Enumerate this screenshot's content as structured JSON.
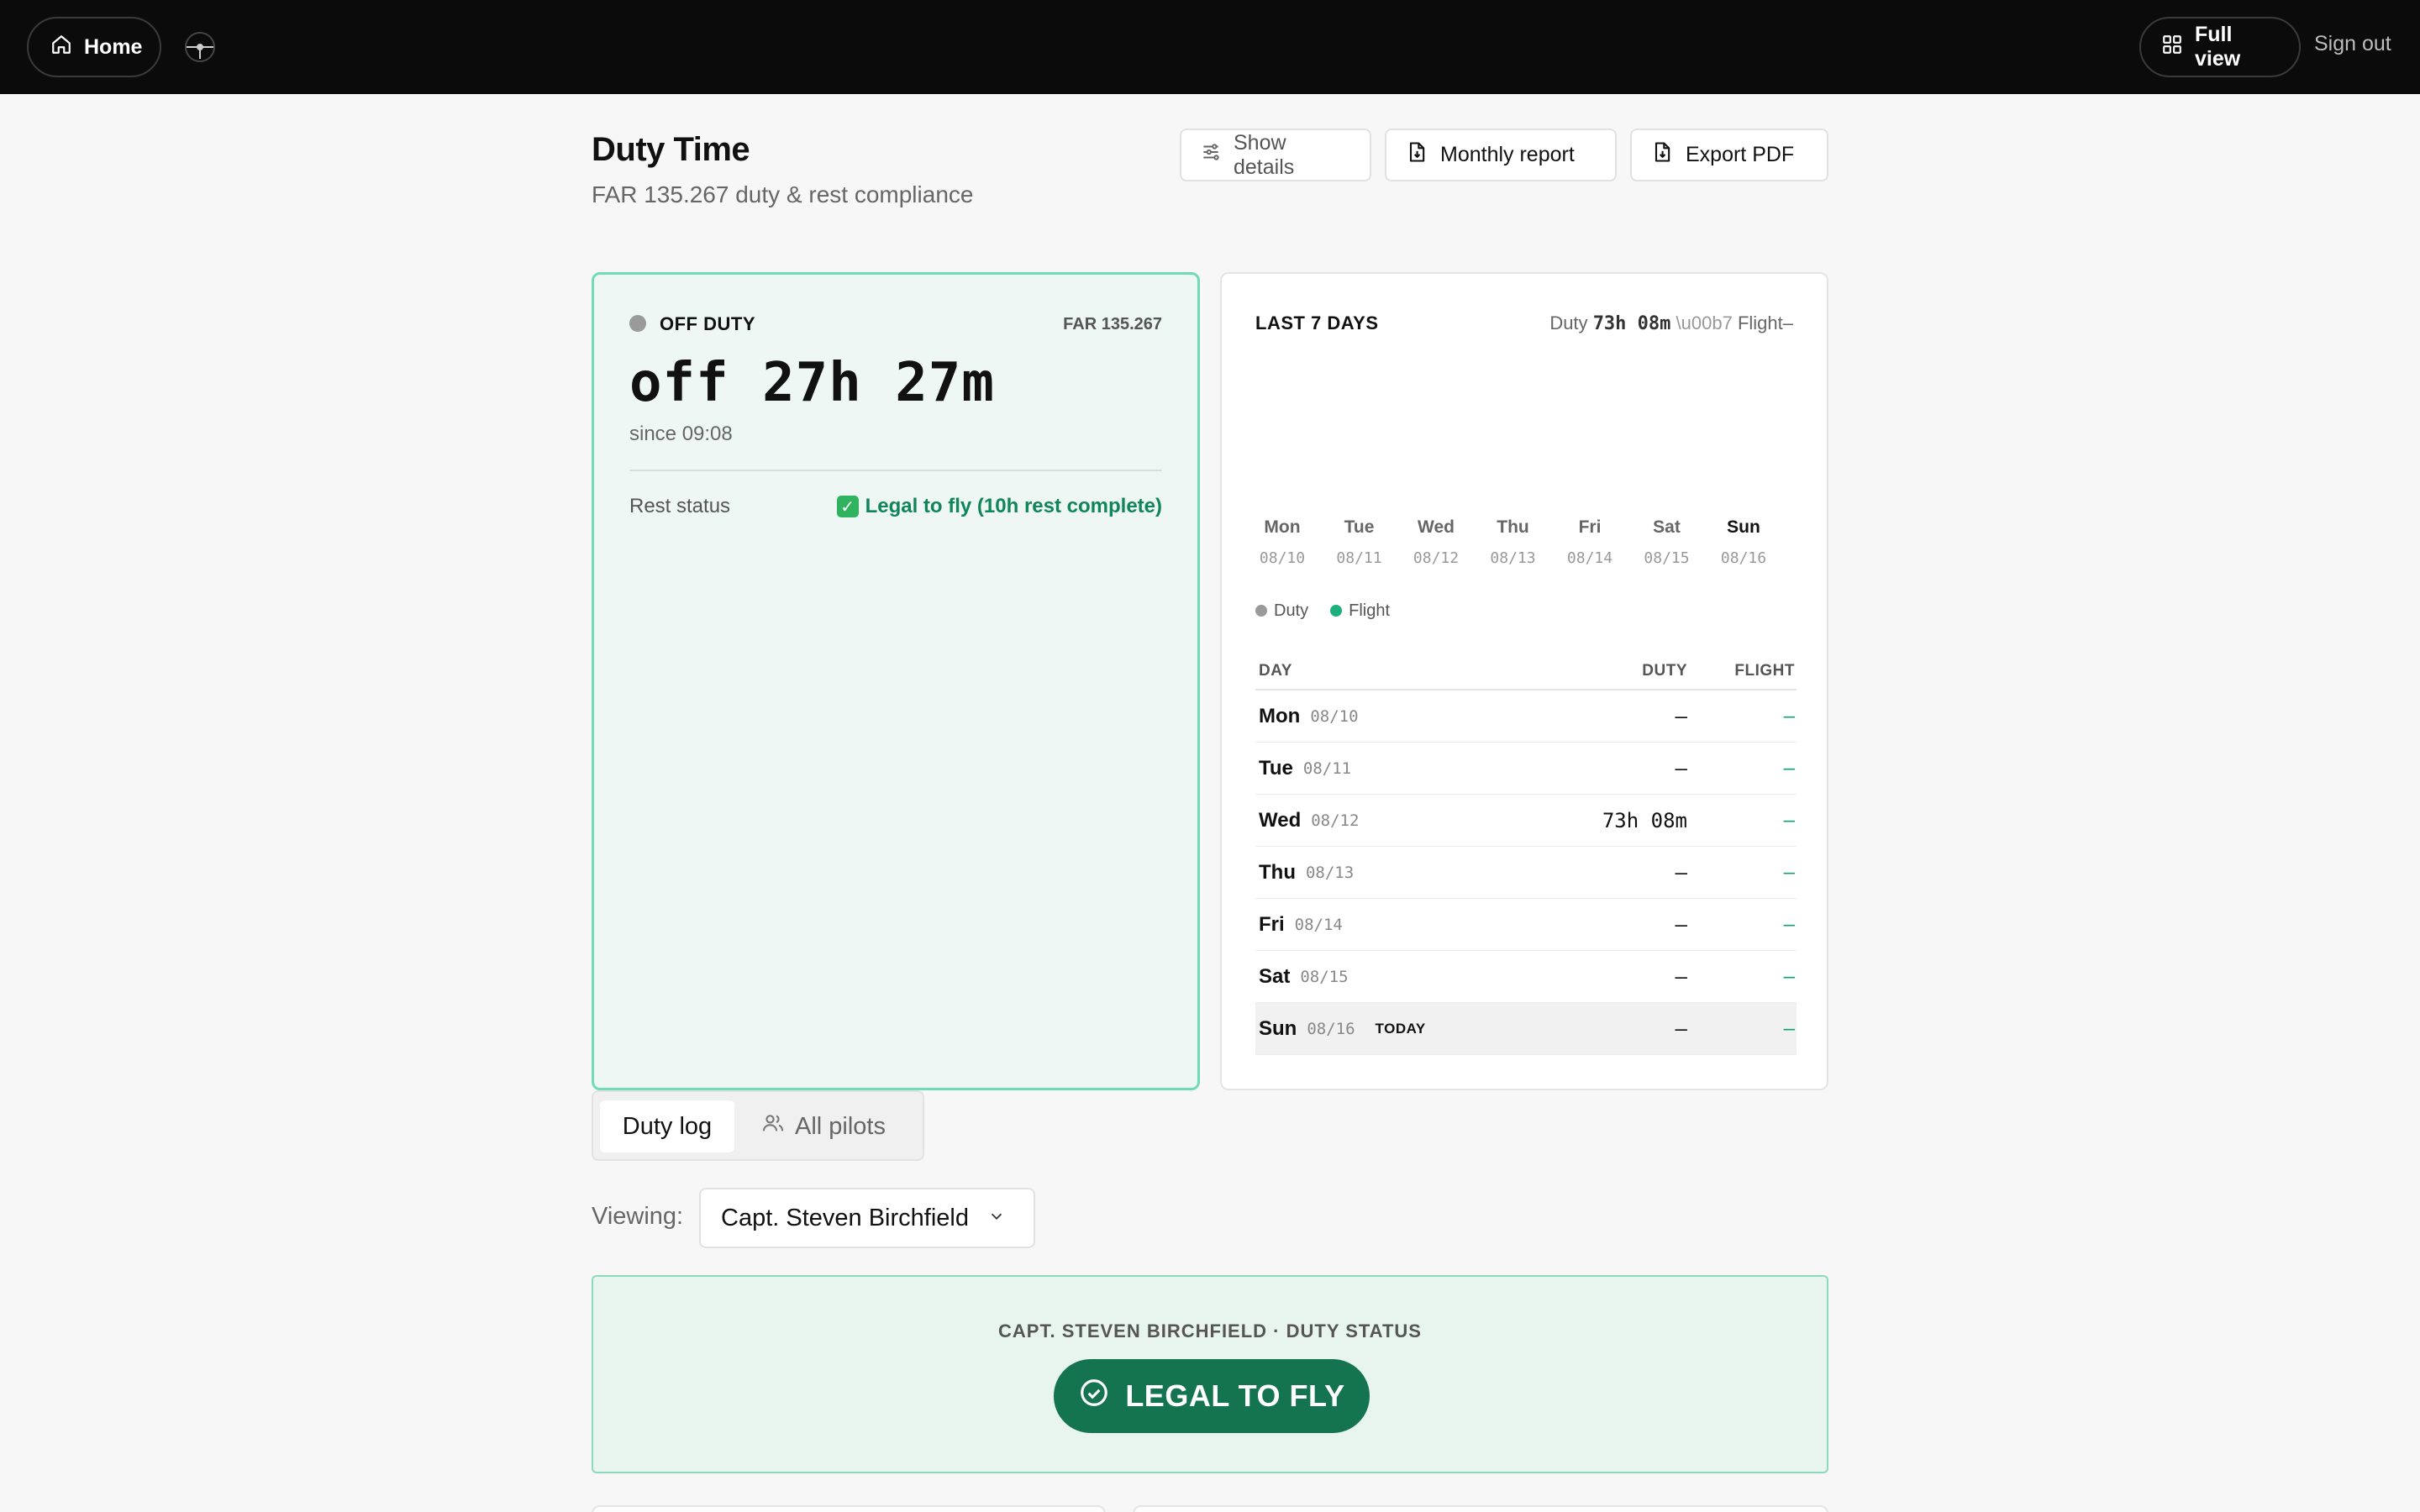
{
  "nav": {
    "home_label": "Home",
    "full_view_label": "Full view",
    "sign_out_label": "Sign out"
  },
  "page": {
    "title": "Duty Time",
    "subtitle": "FAR 135.267 duty & rest compliance"
  },
  "actions": {
    "show_details": "Show details",
    "monthly_report": "Monthly report",
    "export_pdf": "Export PDF"
  },
  "status_card": {
    "state": "OFF DUTY",
    "regulation": "FAR 135.267",
    "elapsed": "off 27h 27m",
    "since": "since 09:08",
    "rest_label": "Rest status",
    "rest_check": "✓",
    "rest_value": "Legal to fly (10h rest complete)"
  },
  "week": {
    "title": "LAST 7 DAYS",
    "summary_duty_label": "Duty",
    "summary_duty_value": "73h 08m",
    "summary_sep": "\\u00b7",
    "summary_flight_label": "Flight",
    "summary_flight_value": "–",
    "days": [
      {
        "name": "Mon",
        "date": "08/10"
      },
      {
        "name": "Tue",
        "date": "08/11"
      },
      {
        "name": "Wed",
        "date": "08/12"
      },
      {
        "name": "Thu",
        "date": "08/13"
      },
      {
        "name": "Fri",
        "date": "08/14"
      },
      {
        "name": "Sat",
        "date": "08/15"
      },
      {
        "name": "Sun",
        "date": "08/16"
      }
    ],
    "legend": {
      "duty": "Duty",
      "flight": "Flight"
    },
    "colors": {
      "duty": "#9a9a9a",
      "flight": "#1cb07c"
    },
    "table": {
      "headers": {
        "day": "DAY",
        "duty": "DUTY",
        "flight": "FLIGHT"
      },
      "rows": [
        {
          "name": "Mon",
          "date": "08/10",
          "duty": "–",
          "flight": "–",
          "tag": ""
        },
        {
          "name": "Tue",
          "date": "08/11",
          "duty": "–",
          "flight": "–",
          "tag": ""
        },
        {
          "name": "Wed",
          "date": "08/12",
          "duty": "73h 08m",
          "flight": "–",
          "tag": ""
        },
        {
          "name": "Thu",
          "date": "08/13",
          "duty": "–",
          "flight": "–",
          "tag": ""
        },
        {
          "name": "Fri",
          "date": "08/14",
          "duty": "–",
          "flight": "–",
          "tag": ""
        },
        {
          "name": "Sat",
          "date": "08/15",
          "duty": "–",
          "flight": "–",
          "tag": ""
        },
        {
          "name": "Sun",
          "date": "08/16",
          "duty": "–",
          "flight": "–",
          "tag": "TODAY"
        }
      ]
    }
  },
  "tabs": {
    "duty_log": "Duty log",
    "all_pilots": "All pilots"
  },
  "viewing": {
    "label": "Viewing:",
    "selected": "Capt. Steven Birchfield"
  },
  "status_panel": {
    "caption": "CAPT. STEVEN BIRCHFIELD · DUTY STATUS",
    "badge": "LEGAL TO FLY"
  }
}
